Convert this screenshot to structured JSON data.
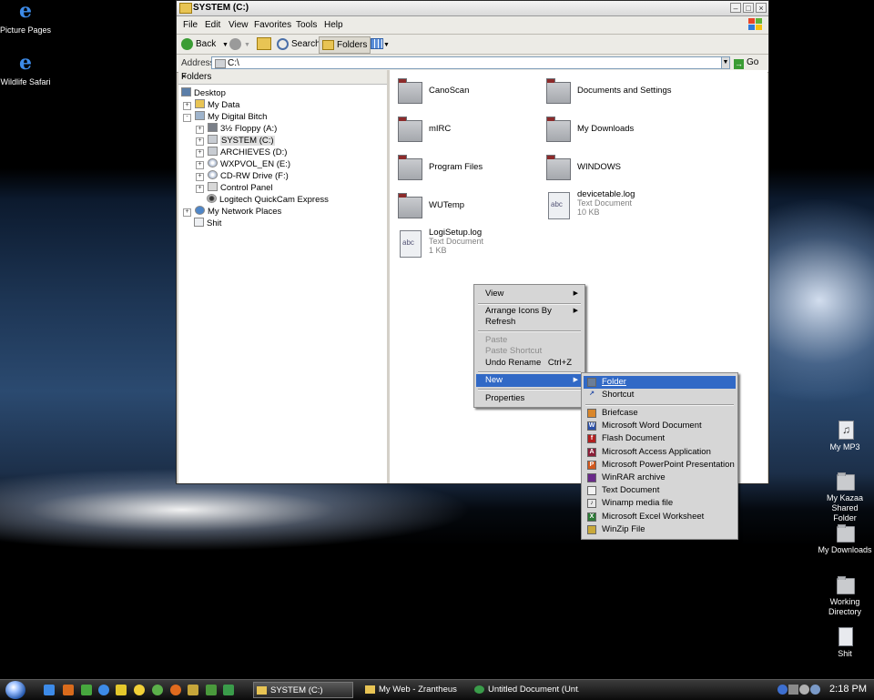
{
  "desktop": {
    "left_icons": [
      {
        "label": "Picture Pages",
        "icon": "ie-icon"
      },
      {
        "label": "Wildlife Safari",
        "icon": "ie-icon"
      }
    ],
    "right_icons": [
      {
        "label": "My MP3",
        "icon": "music-folder-icon"
      },
      {
        "label": "My Kazaa Shared Folder",
        "icon": "folder-icon"
      },
      {
        "label": "My Downloads",
        "icon": "folder-icon"
      },
      {
        "label": "Working Directory",
        "icon": "folder-icon"
      },
      {
        "label": "Shit",
        "icon": "document-icon"
      }
    ]
  },
  "window": {
    "title": "SYSTEM (C:)",
    "menu": [
      "File",
      "Edit",
      "View",
      "Favorites",
      "Tools",
      "Help"
    ],
    "toolbar": {
      "back": "Back",
      "search": "Search",
      "folders": "Folders"
    },
    "address": {
      "label": "Address",
      "value": "C:\\",
      "go": "Go"
    },
    "folders_pane": {
      "title": "Folders",
      "close": "×",
      "tree": [
        {
          "label": "Desktop",
          "level": 0,
          "expander": "",
          "icon": "desktop-icon"
        },
        {
          "label": "My Data",
          "level": 1,
          "expander": "+",
          "icon": "folder-icon"
        },
        {
          "label": "My Digital Bitch",
          "level": 1,
          "expander": "-",
          "icon": "computer-icon"
        },
        {
          "label": "3½ Floppy (A:)",
          "level": 2,
          "expander": "+",
          "icon": "floppy-icon"
        },
        {
          "label": "SYSTEM (C:)",
          "level": 2,
          "expander": "+",
          "icon": "drive-icon",
          "selected": true
        },
        {
          "label": "ARCHIEVES (D:)",
          "level": 2,
          "expander": "+",
          "icon": "drive-icon"
        },
        {
          "label": "WXPVOL_EN (E:)",
          "level": 2,
          "expander": "+",
          "icon": "cd-icon"
        },
        {
          "label": "CD-RW Drive (F:)",
          "level": 2,
          "expander": "+",
          "icon": "cd-icon"
        },
        {
          "label": "Control Panel",
          "level": 2,
          "expander": "+",
          "icon": "control-panel-icon"
        },
        {
          "label": "Logitech QuickCam Express",
          "level": 2,
          "expander": "",
          "icon": "webcam-icon"
        },
        {
          "label": "My Network Places",
          "level": 1,
          "expander": "+",
          "icon": "network-icon"
        },
        {
          "label": "Shit",
          "level": 1,
          "expander": "",
          "icon": "recycle-bin-icon"
        }
      ]
    },
    "files": [
      {
        "name": "CanoScan",
        "type": "folder"
      },
      {
        "name": "Documents and Settings",
        "type": "folder"
      },
      {
        "name": "mIRC",
        "type": "folder"
      },
      {
        "name": "My Downloads",
        "type": "folder"
      },
      {
        "name": "Program Files",
        "type": "folder"
      },
      {
        "name": "WINDOWS",
        "type": "folder"
      },
      {
        "name": "WUTemp",
        "type": "folder"
      },
      {
        "name": "devicetable.log",
        "type": "text",
        "kind": "Text Document",
        "size": "10 KB"
      },
      {
        "name": "LogiSetup.log",
        "type": "text",
        "kind": "Text Document",
        "size": "1 KB"
      }
    ]
  },
  "context_menu": {
    "items": [
      {
        "label": "View",
        "submenu": true,
        "disabled": false
      },
      {
        "label": "Arrange Icons By",
        "submenu": true,
        "disabled": false
      },
      {
        "label": "Refresh",
        "submenu": false,
        "disabled": false
      },
      {
        "label": "Paste",
        "submenu": false,
        "disabled": true
      },
      {
        "label": "Paste Shortcut",
        "submenu": false,
        "disabled": true
      },
      {
        "label": "Undo Rename",
        "submenu": false,
        "disabled": false,
        "accel": "Ctrl+Z"
      },
      {
        "label": "New",
        "submenu": true,
        "disabled": false,
        "highlighted": true
      },
      {
        "label": "Properties",
        "submenu": false,
        "disabled": false
      }
    ]
  },
  "new_submenu": {
    "items": [
      {
        "label": "Folder",
        "icon": "folder-icon",
        "color": "#6b7d98",
        "highlighted": true
      },
      {
        "label": "Shortcut",
        "icon": "shortcut-icon",
        "color": "#d6d6d6"
      },
      {
        "label": "Briefcase",
        "icon": "briefcase-icon",
        "color": "#d9862a"
      },
      {
        "label": "Microsoft Word Document",
        "icon": "word-icon",
        "color": "#2a4fa8"
      },
      {
        "label": "Flash Document",
        "icon": "flash-icon",
        "color": "#b32020"
      },
      {
        "label": "Microsoft Access Application",
        "icon": "access-icon",
        "color": "#8a1e38"
      },
      {
        "label": "Microsoft PowerPoint Presentation",
        "icon": "powerpoint-icon",
        "color": "#d2581e"
      },
      {
        "label": "WinRAR archive",
        "icon": "winrar-icon",
        "color": "#6a2a8a"
      },
      {
        "label": "Text Document",
        "icon": "text-document-icon",
        "color": "#f2f2f2"
      },
      {
        "label": "Winamp media file",
        "icon": "winamp-icon",
        "color": "#e8e8e8"
      },
      {
        "label": "Microsoft Excel Worksheet",
        "icon": "excel-icon",
        "color": "#2c7a36"
      },
      {
        "label": "WinZip File",
        "icon": "winzip-icon",
        "color": "#c9a93a"
      }
    ]
  },
  "taskbar": {
    "tasks": [
      {
        "label": "SYSTEM (C:)",
        "active": true
      },
      {
        "label": "My Web - Zrantheus",
        "active": false
      },
      {
        "label": "Untitled Document (Unt...",
        "active": false
      }
    ],
    "clock": "2:18 PM"
  }
}
